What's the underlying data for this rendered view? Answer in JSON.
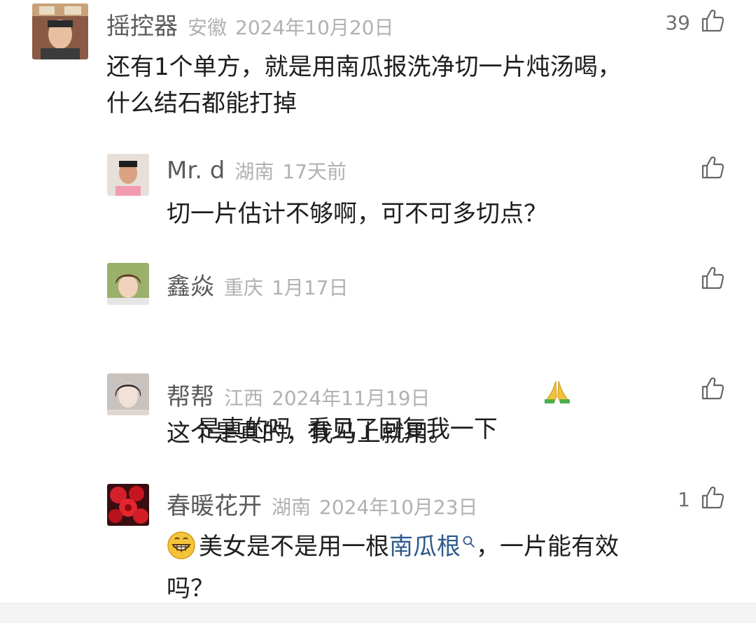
{
  "comments": [
    {
      "username": "摇控器",
      "region": "安徽",
      "time": "2024年10月20日",
      "likes": "39",
      "content_line1": "还有1个单方，就是用南瓜报洗净切一片炖汤喝，",
      "content_line2": "什么结石都能打掉"
    },
    {
      "username": "Mr. d",
      "region": "湖南",
      "time": "17天前",
      "content": "切一片估计不够啊，可不可多切点？"
    },
    {
      "username": "鑫焱",
      "region": "重庆",
      "time": "1月17日",
      "content": "是真的吗  看见了回复我一下",
      "emoji": "folded-hands"
    },
    {
      "username": "帮帮",
      "region": "江西",
      "time": "2024年11月19日",
      "content": "这个是真的，我马上就用。"
    },
    {
      "username": "春暖花开",
      "region": "湖南",
      "time": "2024年10月23日",
      "likes": "1",
      "emoji": "grinning-face",
      "content_before": "美女是不是用一根",
      "content_link": "南瓜根",
      "content_after": "，一片能有效",
      "content_line2": "吗？"
    }
  ],
  "colors": {
    "username": "#5b5b5b",
    "meta": "#b1b1b1",
    "content": "#1e1e1e",
    "link": "#2f5a8c"
  },
  "icons": {
    "like": "thumbs-up-outline-icon",
    "search": "search-icon"
  }
}
